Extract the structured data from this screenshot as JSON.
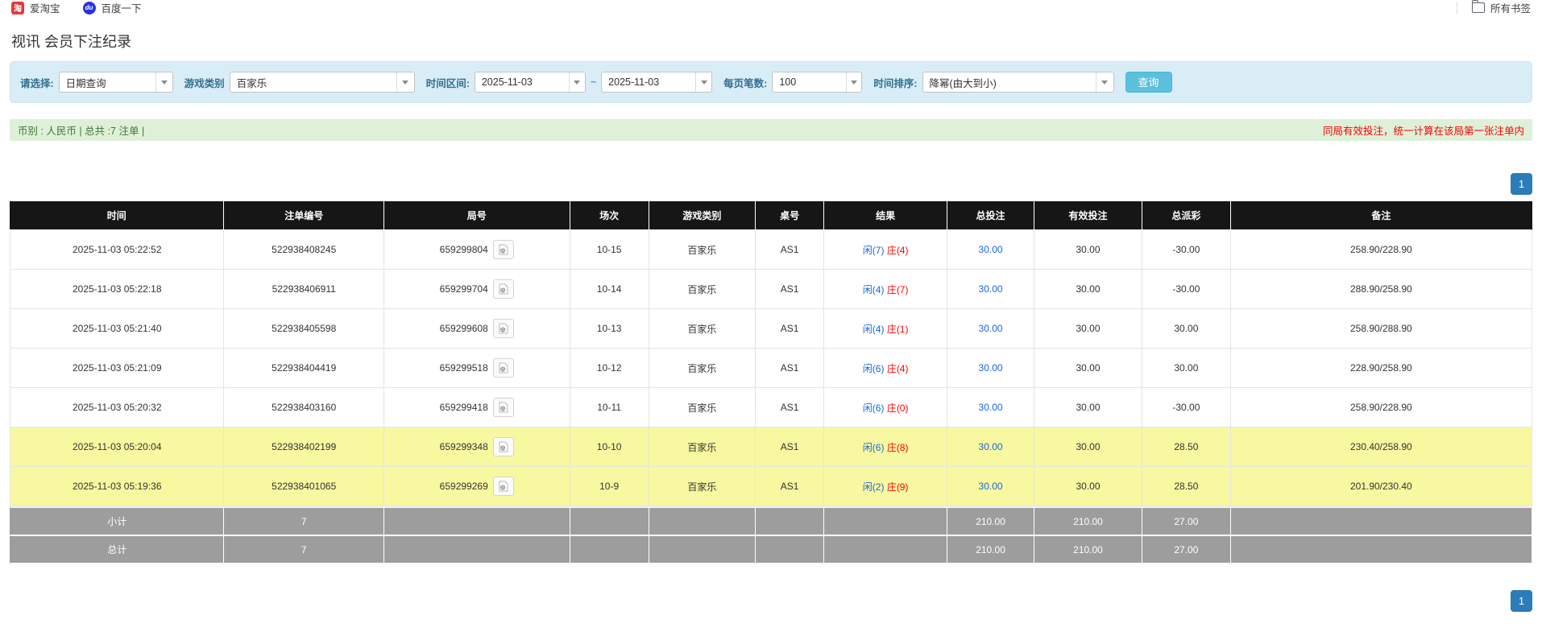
{
  "bookmarks_bar": {
    "items": [
      {
        "label": "爱淘宝",
        "icon": "taobao-icon",
        "icon_color": "#e4393c",
        "glyph": "淘"
      },
      {
        "label": "百度一下",
        "icon": "baidu-icon",
        "icon_color": "#2932e1",
        "glyph": "du"
      }
    ],
    "all_bookmarks_label": "所有书签"
  },
  "page": {
    "title": "视讯 会员下注纪录"
  },
  "filters": {
    "select_label": "请选择:",
    "select_value": "日期查询",
    "game_type_label": "游戏类别",
    "game_type_value": "百家乐",
    "time_range_label": "时间区间:",
    "date_from": "2025-11-03",
    "range_separator": "~",
    "date_to": "2025-11-03",
    "page_size_label": "每页笔数:",
    "page_size_value": "100",
    "sort_label": "时间排序:",
    "sort_value": "降幂(由大到小)",
    "search_button": "查询"
  },
  "summary_bar": {
    "left": "币别 : 人民币 | 总共 :7 注单 |",
    "right": "同局有效投注，统一计算在该局第一张注单内"
  },
  "pagination": {
    "page": "1"
  },
  "table": {
    "headers": [
      "时间",
      "注单编号",
      "局号",
      "场次",
      "游戏类别",
      "桌号",
      "结果",
      "总投注",
      "有效投注",
      "总派彩",
      "备注"
    ],
    "rows": [
      {
        "time": "2025-11-03 05:22:52",
        "bet_id": "522938408245",
        "round": "659299804",
        "session": "10-15",
        "game": "百家乐",
        "table_no": "AS1",
        "result_player": "闲(7)",
        "result_banker": "庄(4)",
        "total_bet": "30.00",
        "valid_bet": "30.00",
        "payout": "-30.00",
        "note": "258.90/228.90",
        "highlight": false
      },
      {
        "time": "2025-11-03 05:22:18",
        "bet_id": "522938406911",
        "round": "659299704",
        "session": "10-14",
        "game": "百家乐",
        "table_no": "AS1",
        "result_player": "闲(4)",
        "result_banker": "庄(7)",
        "total_bet": "30.00",
        "valid_bet": "30.00",
        "payout": "-30.00",
        "note": "288.90/258.90",
        "highlight": false
      },
      {
        "time": "2025-11-03 05:21:40",
        "bet_id": "522938405598",
        "round": "659299608",
        "session": "10-13",
        "game": "百家乐",
        "table_no": "AS1",
        "result_player": "闲(4)",
        "result_banker": "庄(1)",
        "total_bet": "30.00",
        "valid_bet": "30.00",
        "payout": "30.00",
        "note": "258.90/288.90",
        "highlight": false
      },
      {
        "time": "2025-11-03 05:21:09",
        "bet_id": "522938404419",
        "round": "659299518",
        "session": "10-12",
        "game": "百家乐",
        "table_no": "AS1",
        "result_player": "闲(6)",
        "result_banker": "庄(4)",
        "total_bet": "30.00",
        "valid_bet": "30.00",
        "payout": "30.00",
        "note": "228.90/258.90",
        "highlight": false
      },
      {
        "time": "2025-11-03 05:20:32",
        "bet_id": "522938403160",
        "round": "659299418",
        "session": "10-11",
        "game": "百家乐",
        "table_no": "AS1",
        "result_player": "闲(6)",
        "result_banker": "庄(0)",
        "total_bet": "30.00",
        "valid_bet": "30.00",
        "payout": "-30.00",
        "note": "258.90/228.90",
        "highlight": false
      },
      {
        "time": "2025-11-03 05:20:04",
        "bet_id": "522938402199",
        "round": "659299348",
        "session": "10-10",
        "game": "百家乐",
        "table_no": "AS1",
        "result_player": "闲(6)",
        "result_banker": "庄(8)",
        "total_bet": "30.00",
        "valid_bet": "30.00",
        "payout": "28.50",
        "note": "230.40/258.90",
        "highlight": true
      },
      {
        "time": "2025-11-03 05:19:36",
        "bet_id": "522938401065",
        "round": "659299269",
        "session": "10-9",
        "game": "百家乐",
        "table_no": "AS1",
        "result_player": "闲(2)",
        "result_banker": "庄(9)",
        "total_bet": "30.00",
        "valid_bet": "30.00",
        "payout": "28.50",
        "note": "201.90/230.40",
        "highlight": true
      }
    ],
    "subtotal": {
      "label": "小计",
      "count": "7",
      "total_bet": "210.00",
      "valid_bet": "210.00",
      "payout": "27.00"
    },
    "total": {
      "label": "总计",
      "count": "7",
      "total_bet": "210.00",
      "valid_bet": "210.00",
      "payout": "27.00"
    }
  },
  "colors": {
    "header_bg": "#161616",
    "highlight_row": "#f8f8a0",
    "summary_row": "#9d9d9d",
    "link_blue": "#1a66e0",
    "alert_red": "#ff0000",
    "bar_green_bg": "#dff0d8",
    "bar_green_text": "#3c763d",
    "filter_bg": "#d9edf7",
    "search_button_bg": "#5bc0de",
    "pager_bg": "#2b7cb9"
  }
}
